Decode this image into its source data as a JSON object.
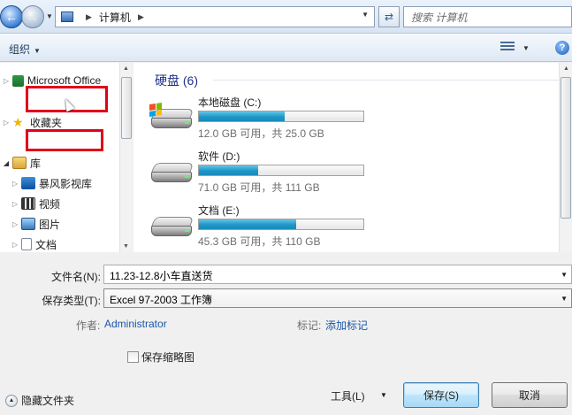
{
  "address": {
    "path": [
      "计算机"
    ],
    "search_placeholder": "搜索 计算机"
  },
  "toolbar": {
    "organize": "组织"
  },
  "nav": {
    "items": [
      {
        "label": "Microsoft Office",
        "top": 0
      },
      {
        "label": "收藏夹"
      },
      {
        "label": "库"
      },
      {
        "label": "暴风影视库"
      },
      {
        "label": "视频"
      },
      {
        "label": "图片"
      },
      {
        "label": "文档"
      }
    ]
  },
  "content": {
    "group_title": "硬盘 (6)",
    "drives": [
      {
        "name": "本地磁盘 (C:)",
        "free": "12.0 GB 可用，共 25.0 GB",
        "used_fraction": 0.52
      },
      {
        "name": "软件 (D:)",
        "free": "71.0 GB 可用，共 111 GB",
        "used_fraction": 0.36
      },
      {
        "name": "文档 (E:)",
        "free": "45.3 GB 可用，共 110 GB",
        "used_fraction": 0.59
      }
    ]
  },
  "form": {
    "filename_label": "文件名(N):",
    "filename_value": "11.23-12.8小车直送货",
    "filetype_label": "保存类型(T):",
    "filetype_value": "Excel 97-2003 工作簿",
    "author_label": "作者:",
    "author_value": "Administrator",
    "tags_label": "标记:",
    "tags_value": "添加标记",
    "thumbnail_label": "保存缩略图"
  },
  "footer": {
    "hide_folders": "隐藏文件夹",
    "tools": "工具(L)",
    "save": "保存(S)",
    "cancel": "取消"
  }
}
